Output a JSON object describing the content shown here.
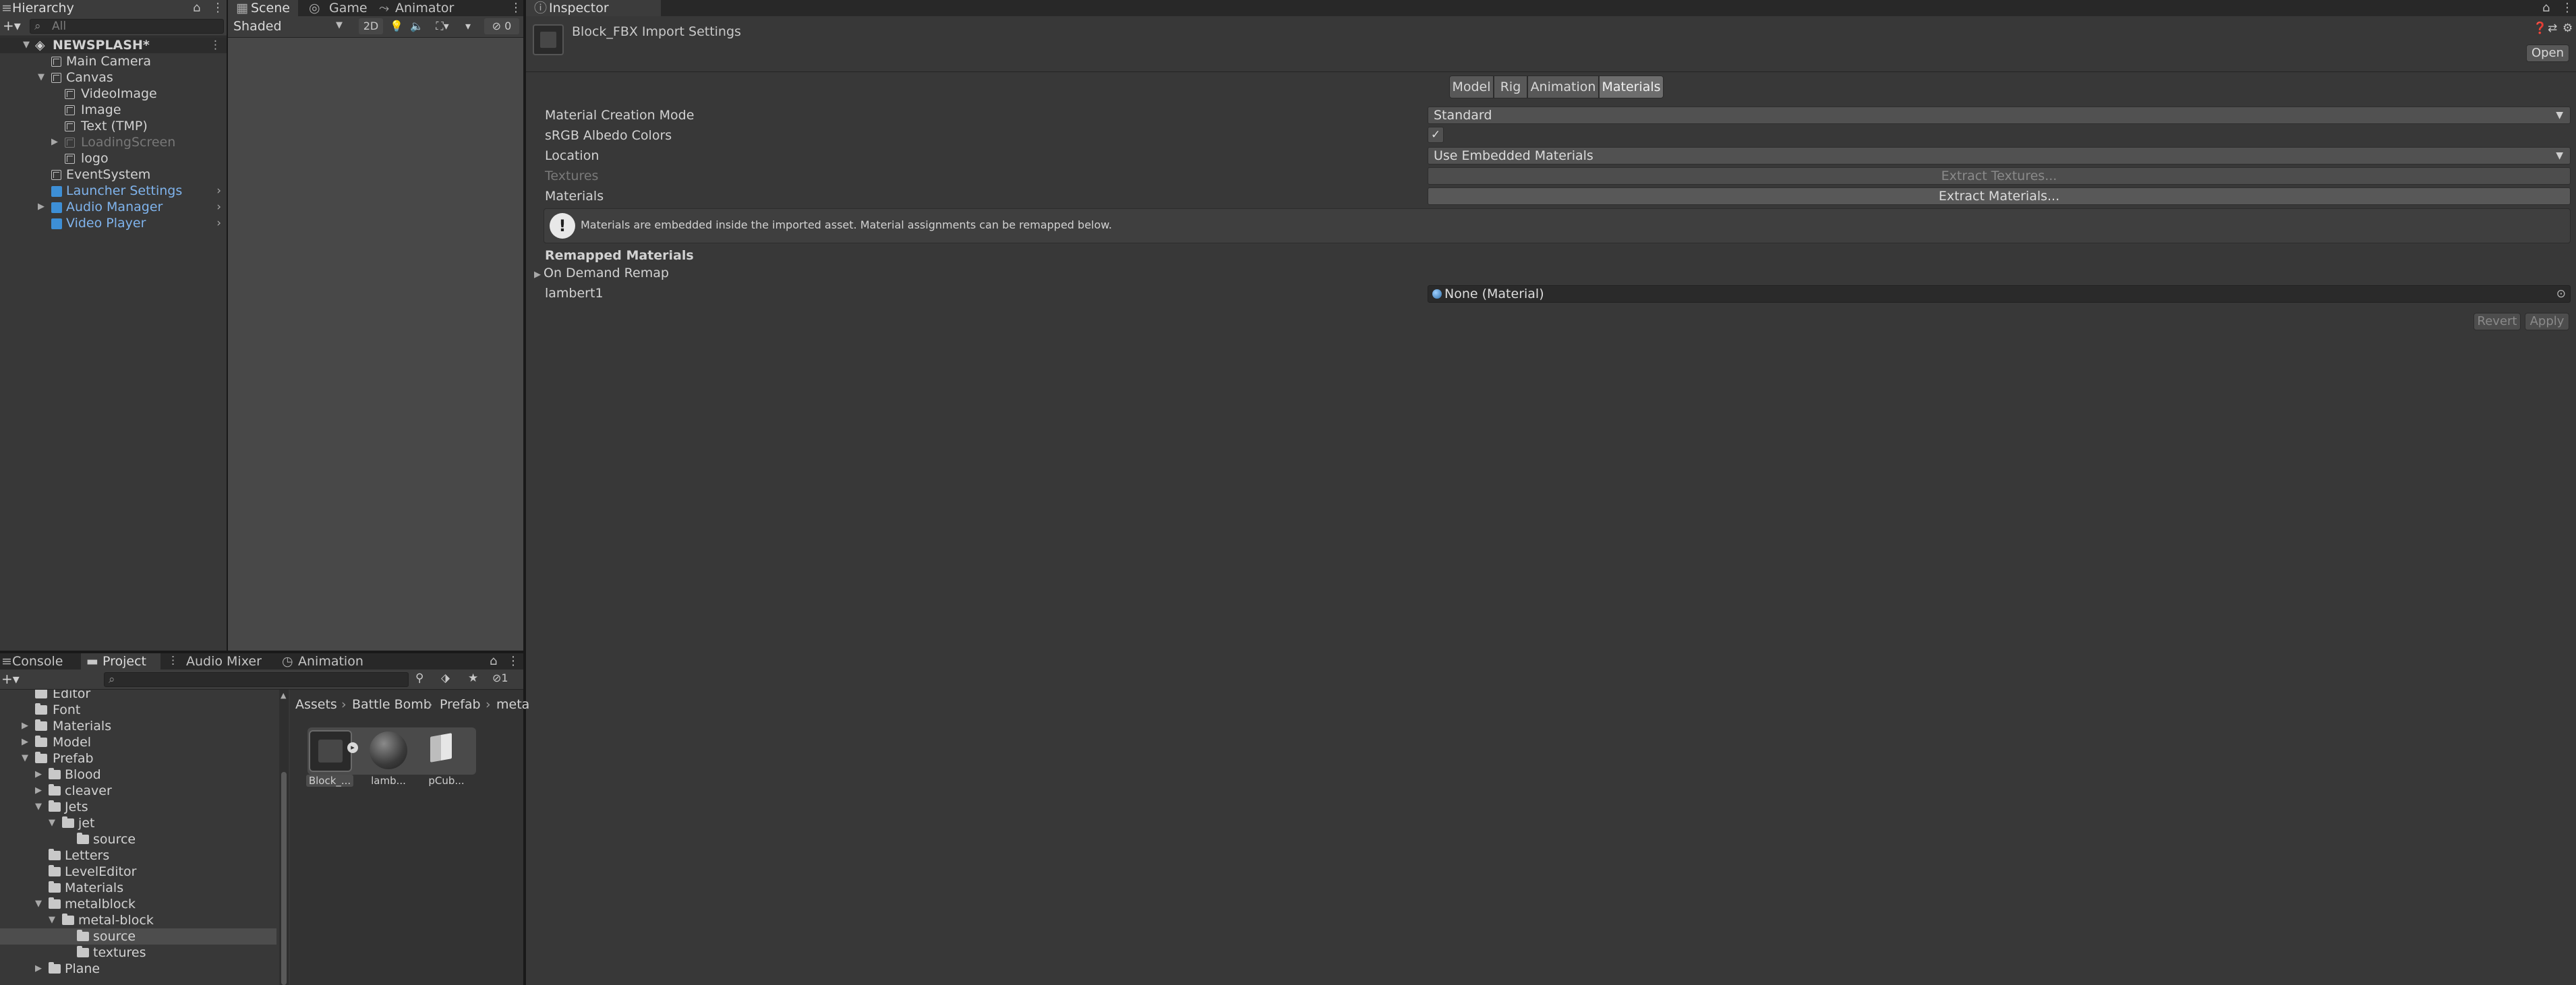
{
  "hierarchy": {
    "tab": "Hierarchy",
    "search_placeholder": "All",
    "scene": "NEWSPLASH*",
    "items": [
      {
        "label": "Main Camera"
      },
      {
        "label": "Canvas"
      },
      {
        "label": "VideoImage"
      },
      {
        "label": "Image"
      },
      {
        "label": "Text (TMP)"
      },
      {
        "label": "LoadingScreen"
      },
      {
        "label": "logo"
      },
      {
        "label": "EventSystem"
      },
      {
        "label": "Launcher Settings"
      },
      {
        "label": "Audio Manager"
      },
      {
        "label": "Video Player"
      }
    ]
  },
  "scene_tabs": {
    "scene": "Scene",
    "game": "Game",
    "animator": "Animator",
    "shading_mode": "Shaded",
    "mode_2d": "2D",
    "hidden_count": "0"
  },
  "inspector": {
    "tab": "Inspector",
    "title": "Block_FBX Import Settings",
    "open_button": "Open",
    "tabs": [
      "Model",
      "Rig",
      "Animation",
      "Materials"
    ],
    "active_tab": "Materials",
    "props": {
      "material_creation_mode_label": "Material Creation Mode",
      "material_creation_mode_value": "Standard",
      "srgb_label": "sRGB Albedo Colors",
      "srgb_checked": "✓",
      "location_label": "Location",
      "location_value": "Use Embedded Materials",
      "textures_label": "Textures",
      "extract_textures": "Extract Textures...",
      "materials_label": "Materials",
      "extract_materials": "Extract Materials..."
    },
    "help": "Materials are embedded inside the imported asset. Material assignments can be remapped below.",
    "remapped_header": "Remapped Materials",
    "on_demand": "On Demand Remap",
    "lambert_label": "lambert1",
    "lambert_value": "None (Material)",
    "revert": "Revert",
    "apply": "Apply"
  },
  "bottom_tabs": {
    "console": "Console",
    "project": "Project",
    "audio_mixer": "Audio Mixer",
    "animation": "Animation",
    "hidden_count": "1"
  },
  "project": {
    "folders": [
      {
        "label": "Editor"
      },
      {
        "label": "Font"
      },
      {
        "label": "Materials"
      },
      {
        "label": "Model"
      },
      {
        "label": "Prefab"
      },
      {
        "label": "Blood"
      },
      {
        "label": "cleaver"
      },
      {
        "label": "Jets"
      },
      {
        "label": "jet"
      },
      {
        "label": "source"
      },
      {
        "label": "Letters"
      },
      {
        "label": "LevelEditor"
      },
      {
        "label": "Materials"
      },
      {
        "label": "metalblock"
      },
      {
        "label": "metal-block"
      },
      {
        "label": "source"
      },
      {
        "label": "textures"
      },
      {
        "label": "Plane"
      }
    ],
    "breadcrumb": [
      "Assets",
      "Battle Bomb",
      "Prefab",
      "meta"
    ],
    "assets": [
      {
        "label": "Block_..."
      },
      {
        "label": "lamb..."
      },
      {
        "label": "pCub..."
      }
    ]
  },
  "colors": {
    "prefab_blue": "#7fb3ec",
    "panel_bg": "#383838",
    "tab_bg": "#282828"
  }
}
